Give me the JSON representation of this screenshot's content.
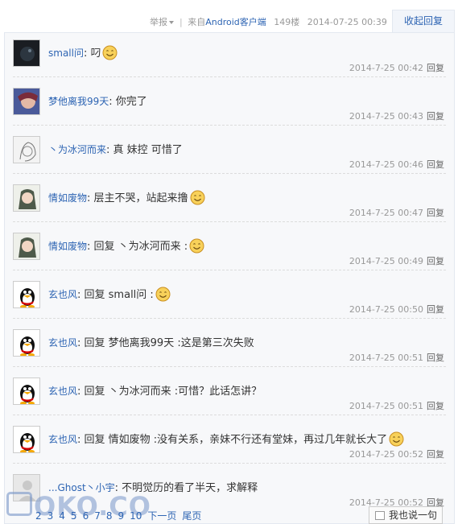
{
  "header": {
    "report_label": "举报",
    "source_prefix": "来自",
    "source_client": "Android客户端",
    "floor": "149楼",
    "datetime": "2014-07-25 00:39",
    "collapse_label": "收起回复"
  },
  "comments": [
    {
      "user": "small问",
      "text": ": 叼",
      "smiley": true,
      "time": "2014-7-25 00:42",
      "reply": "回复",
      "avatar": "avatar-dark"
    },
    {
      "user": "梦他离我99天",
      "text": ": 你完了",
      "smiley": false,
      "time": "2014-7-25 00:43",
      "reply": "回复",
      "avatar": "avatar-anime"
    },
    {
      "user": "丶为冰河而来",
      "text": ": 真 妹控 可惜了",
      "smiley": false,
      "time": "2014-7-25 00:46",
      "reply": "回复",
      "avatar": "avatar-sketch"
    },
    {
      "user": "情如废物",
      "text": ": 层主不哭，站起来撸",
      "smiley": true,
      "time": "2014-7-25 00:47",
      "reply": "回复",
      "avatar": "avatar-girl"
    },
    {
      "user": "情如废物",
      "text": ": 回复 丶为冰河而来 :",
      "smiley": true,
      "time": "2014-7-25 00:49",
      "reply": "回复",
      "avatar": "avatar-girl"
    },
    {
      "user": "玄也风",
      "text": ": 回复 small问 :",
      "smiley": true,
      "time": "2014-7-25 00:50",
      "reply": "回复",
      "avatar": "avatar-qq"
    },
    {
      "user": "玄也风",
      "text": ": 回复 梦他离我99天 :这是第三次失败",
      "smiley": false,
      "time": "2014-7-25 00:51",
      "reply": "回复",
      "avatar": "avatar-qq"
    },
    {
      "user": "玄也风",
      "text": ": 回复 丶为冰河而来 :可惜？此话怎讲？",
      "smiley": false,
      "time": "2014-7-25 00:51",
      "reply": "回复",
      "avatar": "avatar-qq"
    },
    {
      "user": "玄也风",
      "text": ": 回复 情如废物 :没有关系，亲妹不行还有堂妹，再过几年就长大了",
      "smiley": true,
      "time": "2014-7-25 00:52",
      "reply": "回复",
      "avatar": "avatar-qq"
    },
    {
      "user": "...Ghost丶小宇",
      "text": ": 不明觉历的看了半天，求解释",
      "smiley": false,
      "time": "2014-7-25 00:52",
      "reply": "回复",
      "avatar": "avatar-blank"
    }
  ],
  "pager": {
    "pages": [
      "2",
      "3",
      "4",
      "5",
      "6",
      "7",
      "8",
      "9",
      "10"
    ],
    "next": "下一页",
    "last": "尾页"
  },
  "say_button": "我也说一句",
  "watermark": "OKO.CO"
}
